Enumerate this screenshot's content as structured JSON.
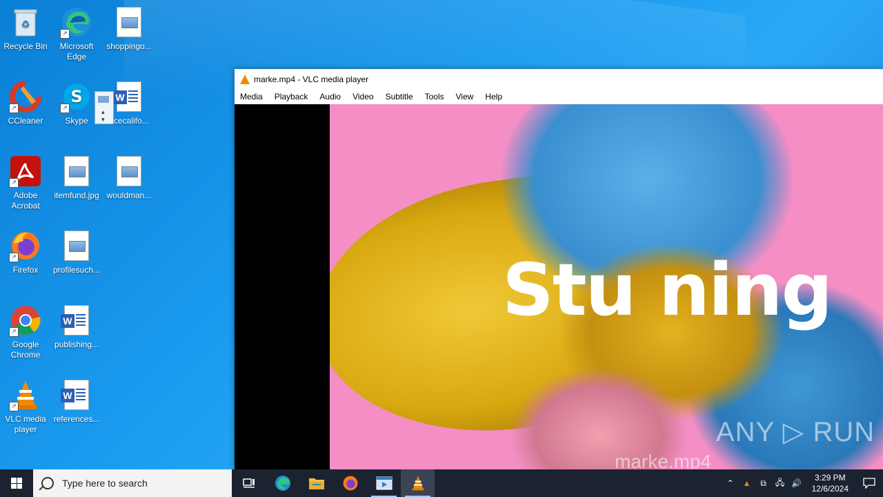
{
  "desktop": {
    "icons": [
      {
        "label": "Recycle Bin"
      },
      {
        "label": "Microsoft Edge"
      },
      {
        "label": "shoppingo..."
      },
      {
        "label": "CCleaner"
      },
      {
        "label": "Skype"
      },
      {
        "label": "acecalifo..."
      },
      {
        "label": "Adobe Acrobat"
      },
      {
        "label": "itemfund.jpg"
      },
      {
        "label": "wouldman..."
      },
      {
        "label": "Firefox"
      },
      {
        "label": "profilesuch..."
      },
      {
        "label": "Google Chrome"
      },
      {
        "label": "publishing..."
      },
      {
        "label": "VLC media player"
      },
      {
        "label": "references..."
      }
    ]
  },
  "vlc": {
    "title": "marke.mp4 - VLC media player",
    "menu": [
      "Media",
      "Playback",
      "Audio",
      "Video",
      "Subtitle",
      "Tools",
      "View",
      "Help"
    ],
    "video": {
      "overlay_text": "Stu ning",
      "watermark": "ANY ▷ RUN",
      "filename_overlay": "marke.mp4"
    }
  },
  "taskbar": {
    "search_placeholder": "Type here to search",
    "clock_time": "3:29 PM",
    "clock_date": "12/6/2024"
  },
  "colors": {
    "desktop_bg": "#1a9bef",
    "taskbar_bg": "#1b2330",
    "vlc_orange": "#f08a00",
    "video_pink": "#f48ec5"
  }
}
